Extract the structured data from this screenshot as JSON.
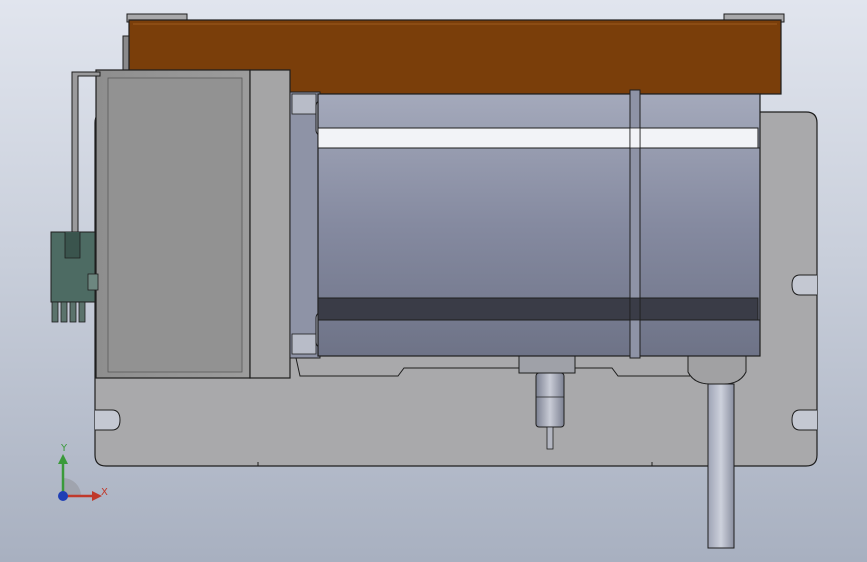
{
  "viewport": {
    "background_top": "#e1e5ee",
    "background_bottom": "#a8b0c0"
  },
  "model": {
    "components": [
      "base-plate",
      "top-cover-bracket",
      "stepper-motor-body",
      "motor-end-cap",
      "motor-flange",
      "terminal-connector",
      "encoder-shaft",
      "power-cable"
    ],
    "colors": {
      "base_plate": "#a9a9ab",
      "top_cover": "#7a3e0a",
      "motor_body": "#8a8fa3",
      "end_cap": "#969696",
      "connector": "#4d6b63",
      "edge": "#1e1e1e"
    }
  },
  "triad": {
    "x_label": "X",
    "y_label": "Y",
    "x_color": "#c0392b",
    "y_color": "#3a9a3a",
    "z_color": "#1f3fb5"
  }
}
